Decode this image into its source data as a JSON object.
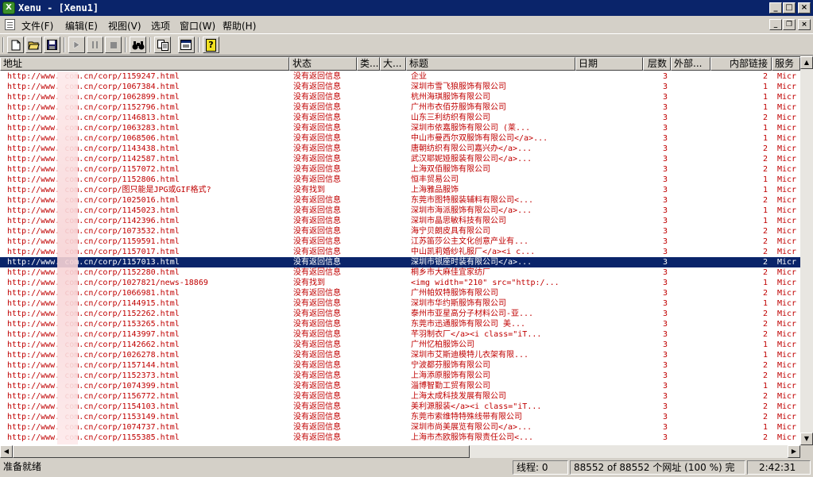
{
  "window": {
    "title": "Xenu - [Xenu1]",
    "controls": {
      "minimize": "_",
      "maximize": "□",
      "close": "×"
    }
  },
  "menubar": {
    "items": [
      "文件(F)",
      "编辑(E)",
      "视图(V)",
      "选项",
      "窗口(W)",
      "帮助(H)"
    ],
    "mdi_controls": {
      "minimize": "_",
      "restore": "❐",
      "close": "×"
    }
  },
  "toolbar": {
    "buttons": [
      {
        "name": "new-icon",
        "glyph": "🗋",
        "enabled": true
      },
      {
        "name": "open-folder-icon",
        "glyph": "📂",
        "enabled": true
      },
      {
        "name": "save-icon",
        "glyph": "💾",
        "enabled": true
      },
      {
        "name": "play-icon",
        "glyph": "▶",
        "enabled": false
      },
      {
        "name": "pause-icon",
        "glyph": "❚❚",
        "enabled": false
      },
      {
        "name": "stop-icon",
        "glyph": "■",
        "enabled": false
      },
      {
        "name": "binoculars-icon",
        "glyph": "👓",
        "enabled": true
      },
      {
        "name": "copy-icon",
        "glyph": "⧉",
        "enabled": true
      },
      {
        "name": "properties-icon",
        "glyph": "🗔",
        "enabled": true
      },
      {
        "name": "help-icon",
        "glyph": "?",
        "enabled": true
      }
    ]
  },
  "columns": [
    "地址",
    "状态",
    "类...",
    "大...",
    "标题",
    "日期",
    "层数",
    "外部...",
    "内部链接",
    "服务"
  ],
  "rows": [
    {
      "url": "http://www.      com.cn/corp/1159247.html",
      "status": "没有返回信息",
      "title": "企业",
      "level": "3",
      "inner": "2",
      "server": "Micr"
    },
    {
      "url": "http://www.      com.cn/corp/1067384.html",
      "status": "没有返回信息",
      "title": "深圳市雪飞狼服饰有限公司",
      "level": "3",
      "inner": "1",
      "server": "Micr"
    },
    {
      "url": "http://www.      com.cn/corp/1062899.html",
      "status": "没有返回信息",
      "title": "杭州海琪服饰有限公司",
      "level": "3",
      "inner": "1",
      "server": "Micr"
    },
    {
      "url": "http://www.      com.cn/corp/1152796.html",
      "status": "没有返回信息",
      "title": "广州市衣佰芬服饰有限公司",
      "level": "3",
      "inner": "1",
      "server": "Micr"
    },
    {
      "url": "http://www.      com.cn/corp/1146813.html",
      "status": "没有返回信息",
      "title": "山东三利纺织有限公司",
      "level": "3",
      "inner": "2",
      "server": "Micr"
    },
    {
      "url": "http://www.      com.cn/corp/1063283.html",
      "status": "没有返回信息",
      "title": "深圳市依嘉服饰有限公司 (莱...",
      "level": "3",
      "inner": "1",
      "server": "Micr"
    },
    {
      "url": "http://www.      com.cn/corp/1068506.html",
      "status": "没有返回信息",
      "title": "中山市曼西尔双服饰有限公司</a>...",
      "level": "3",
      "inner": "1",
      "server": "Micr"
    },
    {
      "url": "http://www.      com.cn/corp/1143438.html",
      "status": "没有返回信息",
      "title": "唐朝纺织有限公司嘉兴办</a>...",
      "level": "3",
      "inner": "2",
      "server": "Micr"
    },
    {
      "url": "http://www.      com.cn/corp/1142587.html",
      "status": "没有返回信息",
      "title": "武汉耶妮娅服装有限公司</a>...",
      "level": "3",
      "inner": "2",
      "server": "Micr"
    },
    {
      "url": "http://www.      com.cn/corp/1157072.html",
      "status": "没有返回信息",
      "title": "上海双佰服饰有限公司",
      "level": "3",
      "inner": "2",
      "server": "Micr"
    },
    {
      "url": "http://www.      com.cn/corp/1152806.html",
      "status": "没有返回信息",
      "title": "恒丰贸易公司",
      "level": "3",
      "inner": "1",
      "server": "Micr"
    },
    {
      "url": "http://www.      com.cn/corp/图只能是JPG或GIF格式?",
      "status": "没有找到",
      "title": "上海雅品服饰",
      "level": "3",
      "inner": "1",
      "server": "Micr"
    },
    {
      "url": "http://www.      com.cn/corp/1025016.html",
      "status": "没有返回信息",
      "title": "东莞市图特服装辅料有限公司<...",
      "level": "3",
      "inner": "2",
      "server": "Micr"
    },
    {
      "url": "http://www.      com.cn/corp/1145023.html",
      "status": "没有返回信息",
      "title": "深圳市海派服饰有限公司</a>...",
      "level": "3",
      "inner": "1",
      "server": "Micr"
    },
    {
      "url": "http://www.      com.cn/corp/1142396.html",
      "status": "没有返回信息",
      "title": "深圳市晶思敏科技有限公司",
      "level": "3",
      "inner": "1",
      "server": "Micr"
    },
    {
      "url": "http://www.      com.cn/corp/1073532.html",
      "status": "没有返回信息",
      "title": "海宁贝朗皮具有限公司",
      "level": "3",
      "inner": "2",
      "server": "Micr"
    },
    {
      "url": "http://www.      com.cn/corp/1159591.html",
      "status": "没有返回信息",
      "title": "江苏笛莎公主文化创意产业有...",
      "level": "3",
      "inner": "2",
      "server": "Micr"
    },
    {
      "url": "http://www.      com.cn/corp/1157017.html",
      "status": "没有返回信息",
      "title": "中山凯莉婚纱礼服厂</a><i c...",
      "level": "3",
      "inner": "2",
      "server": "Micr"
    },
    {
      "url": "http://www.      com.cn/corp/1157013.html",
      "status": "没有返回信息",
      "title": "深圳市银座时装有限公司</a>...",
      "level": "3",
      "inner": "2",
      "server": "Micr",
      "selected": true
    },
    {
      "url": "http://www.      com.cn/corp/1152280.html",
      "status": "没有返回信息",
      "title": "桐乡市大麻佳宜家纺厂",
      "level": "3",
      "inner": "2",
      "server": "Micr"
    },
    {
      "url": "http://www.      com.cn/corp/1027821/news-18869",
      "status": "没有找到",
      "title": "<img width=\"210\" src=\"http:/...",
      "level": "3",
      "inner": "1",
      "server": "Micr"
    },
    {
      "url": "http://www.      com.cn/corp/1066981.html",
      "status": "没有返回信息",
      "title": "广州帕奴特服饰有限公司",
      "level": "3",
      "inner": "2",
      "server": "Micr"
    },
    {
      "url": "http://www.      com.cn/corp/1144915.html",
      "status": "没有返回信息",
      "title": "深圳市华约斯服饰有限公司",
      "level": "3",
      "inner": "1",
      "server": "Micr"
    },
    {
      "url": "http://www.      com.cn/corp/1152262.html",
      "status": "没有返回信息",
      "title": "泰州市亚星高分子材料公司-亚...",
      "level": "3",
      "inner": "2",
      "server": "Micr"
    },
    {
      "url": "http://www.      com.cn/corp/1153265.html",
      "status": "没有返回信息",
      "title": "东莞市迅通服饰有限公司  美...",
      "level": "3",
      "inner": "2",
      "server": "Micr"
    },
    {
      "url": "http://www.      com.cn/corp/1143997.html",
      "status": "没有返回信息",
      "title": "芊羽制衣厂</a><i class=\"iT...",
      "level": "3",
      "inner": "2",
      "server": "Micr"
    },
    {
      "url": "http://www.      com.cn/corp/1142662.html",
      "status": "没有返回信息",
      "title": "广州忆柏服饰公司",
      "level": "3",
      "inner": "1",
      "server": "Micr"
    },
    {
      "url": "http://www.      com.cn/corp/1026278.html",
      "status": "没有返回信息",
      "title": "深圳市艾斯迪模特儿衣架有限...",
      "level": "3",
      "inner": "1",
      "server": "Micr"
    },
    {
      "url": "http://www.      com.cn/corp/1157144.html",
      "status": "没有返回信息",
      "title": "宁波都芬服饰有限公司",
      "level": "3",
      "inner": "2",
      "server": "Micr"
    },
    {
      "url": "http://www.      com.cn/corp/1152373.html",
      "status": "没有返回信息",
      "title": "上海添原服饰有限公司",
      "level": "3",
      "inner": "2",
      "server": "Micr"
    },
    {
      "url": "http://www.      com.cn/corp/1074399.html",
      "status": "没有返回信息",
      "title": "淄博智勤工贸有限公司",
      "level": "3",
      "inner": "1",
      "server": "Micr"
    },
    {
      "url": "http://www.      com.cn/corp/1156772.html",
      "status": "没有返回信息",
      "title": "上海太成科技发展有限公司",
      "level": "3",
      "inner": "2",
      "server": "Micr"
    },
    {
      "url": "http://www.      com.cn/corp/1154103.html",
      "status": "没有返回信息",
      "title": "美利源服装</a><i class=\"iT...",
      "level": "3",
      "inner": "2",
      "server": "Micr"
    },
    {
      "url": "http://www.      com.cn/corp/1153149.html",
      "status": "没有返回信息",
      "title": "东莞市索维特特殊线带有限公司",
      "level": "3",
      "inner": "2",
      "server": "Micr"
    },
    {
      "url": "http://www.      com.cn/corp/1074737.html",
      "status": "没有返回信息",
      "title": "深圳市尚美展览有限公司</a>...",
      "level": "3",
      "inner": "1",
      "server": "Micr"
    },
    {
      "url": "http://www.      com.cn/corp/1155385.html",
      "status": "没有返回信息",
      "title": "上海市杰欧服饰有限责任公司<...",
      "level": "3",
      "inner": "2",
      "server": "Micr"
    }
  ],
  "statusbar": {
    "ready": "准备就绪",
    "threads": "线程: 0",
    "progress": "88552 of 88552 个网址 (100 %) 完",
    "elapsed": "2:42:31"
  },
  "colors": {
    "titlebar": "#0a246a",
    "link_text": "#c00000",
    "selection": "#0a246a",
    "face": "#d4d0c8"
  }
}
